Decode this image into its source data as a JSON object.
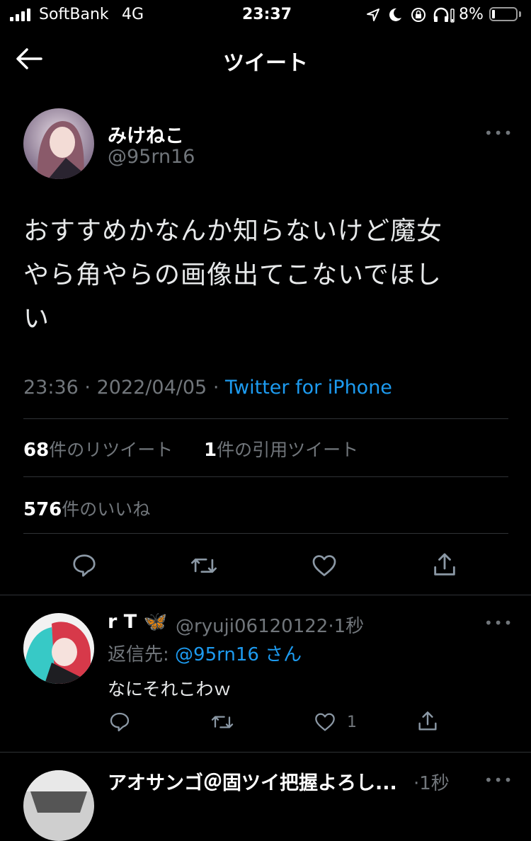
{
  "status_bar": {
    "carrier": "SoftBank",
    "network": "4G",
    "time": "23:37",
    "battery": "8%",
    "battery_level": 0.08
  },
  "header": {
    "title": "ツイート"
  },
  "tweet": {
    "name": "みけねこ",
    "handle": "@95rn16",
    "text_lines": [
      "おすすめかなんか知らないけど魔女",
      "やら角やらの画像出てこないでほし",
      "い"
    ],
    "time": "23:36",
    "date": "2022/04/05",
    "separator": "·",
    "source": "Twitter for iPhone",
    "retweets_count": "68",
    "retweets_label": "件のリツイート",
    "quotes_count": "1",
    "quotes_label": "件の引用ツイート",
    "likes_count": "576",
    "likes_label": "件のいいね",
    "more": "•••"
  },
  "replies": [
    {
      "name": "r T",
      "emoji": "🦋",
      "handle": "@ryuji06120122",
      "time": "·1秒",
      "reply_to_label": "返信先:",
      "reply_to_handle": "@95rn16 さん",
      "text": "なにそれこわｗ",
      "like_count": "1",
      "more": "•••"
    },
    {
      "name": "アオサンゴ＠固ツイ把握よろし...",
      "time": "·1秒",
      "more": "•••"
    }
  ],
  "colors": {
    "background": "#000000",
    "accent": "#1d9bf0",
    "muted": "#71767b",
    "divider": "#2f3336"
  }
}
